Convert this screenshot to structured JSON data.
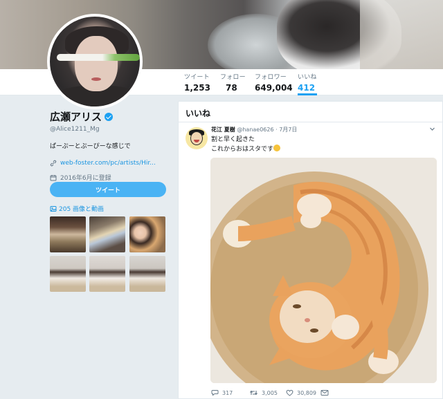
{
  "profile": {
    "name": "広瀬アリス",
    "handle": "@Alice1211_Mg",
    "bio": "ぱーぷーとぷーぴーな感じで",
    "website": "web-foster.com/pc/artists/Hir...",
    "joined": "2016年6月に登録",
    "tweet_button": "ツイート",
    "media_link": "205 画像と動画"
  },
  "nav": {
    "stats": [
      {
        "label": "ツイート",
        "value": "1,253"
      },
      {
        "label": "フォロー",
        "value": "78"
      },
      {
        "label": "フォロワー",
        "value": "649,004"
      },
      {
        "label": "いいね",
        "value": "412"
      }
    ],
    "active": "いいね"
  },
  "timeline": {
    "heading": "いいね",
    "tweet": {
      "author": "花江 夏樹",
      "handle": "@hanae0626",
      "separator": "·",
      "date": "7月7日",
      "line1": "割と早く起きた",
      "line2": "これからおはスタです",
      "replies": "317",
      "retweets": "3,005",
      "likes": "30,809"
    }
  },
  "colors": {
    "accent": "#1da1f2",
    "link": "#1b95e0",
    "background": "#e6ecf0"
  },
  "icons": [
    "verified-badge-icon",
    "link-icon",
    "calendar-icon",
    "image-icon",
    "chevron-down-icon",
    "reply-icon",
    "retweet-icon",
    "heart-icon",
    "mail-icon"
  ]
}
